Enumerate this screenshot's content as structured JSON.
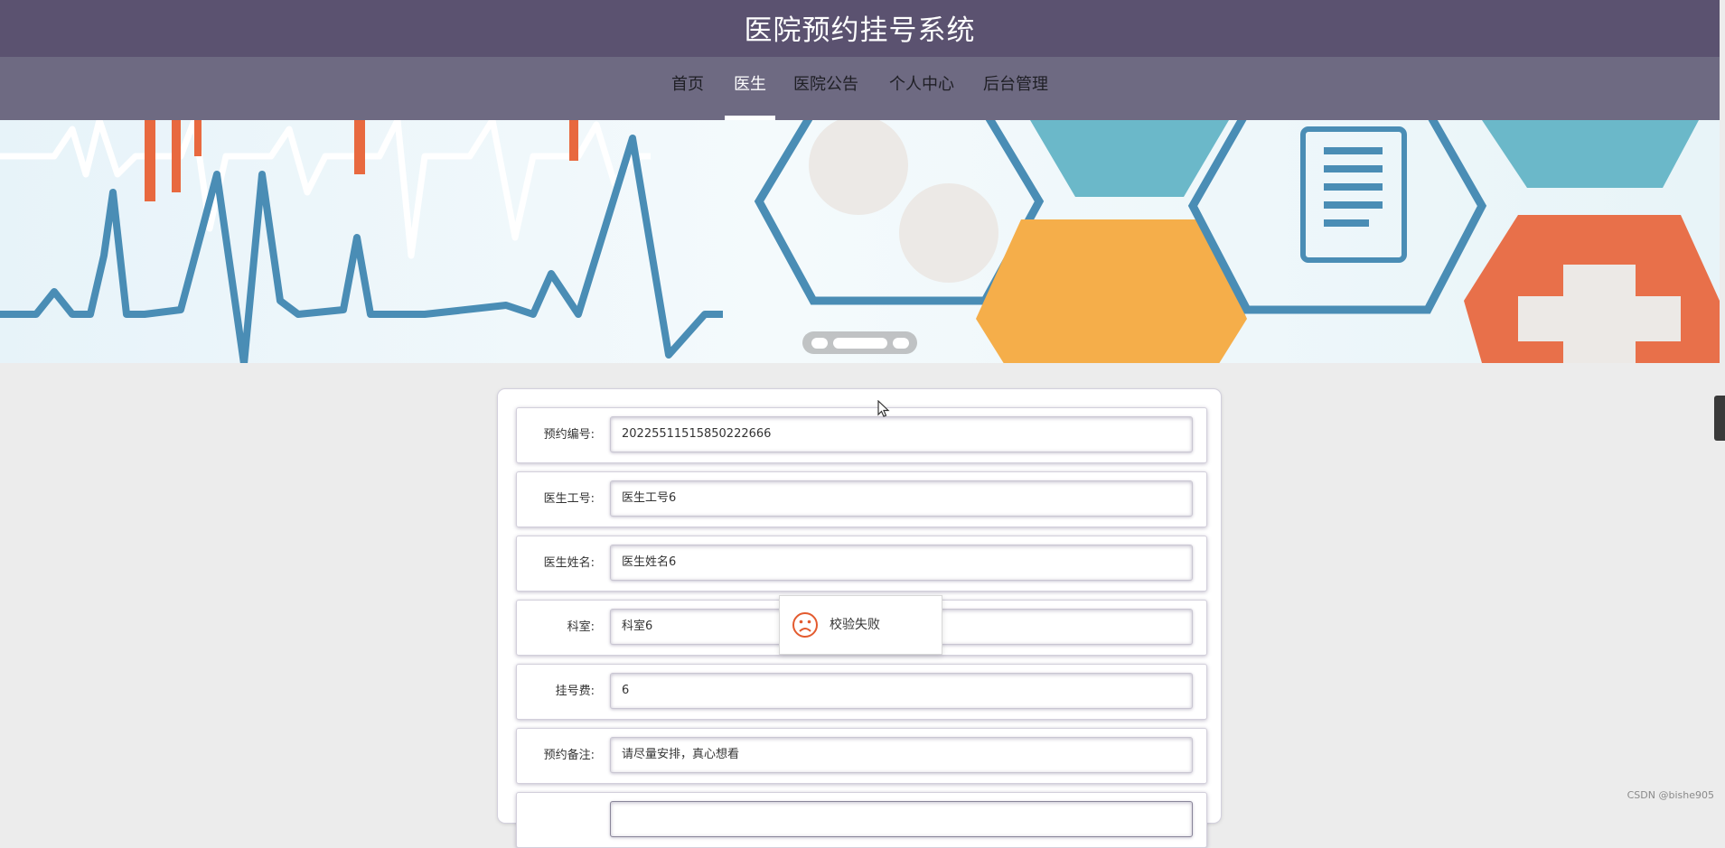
{
  "header": {
    "title": "医院预约挂号系统"
  },
  "nav": {
    "items": [
      {
        "label": "首页",
        "active": false
      },
      {
        "label": "医生",
        "active": true
      },
      {
        "label": "医院公告",
        "active": false
      },
      {
        "label": "个人中心",
        "active": false
      },
      {
        "label": "后台管理",
        "active": false
      }
    ]
  },
  "form": {
    "fields": [
      {
        "label": "预约编号:",
        "value": "20225511515850222666"
      },
      {
        "label": "医生工号:",
        "value": "医生工号6"
      },
      {
        "label": "医生姓名:",
        "value": "医生姓名6"
      },
      {
        "label": "科室:",
        "value": "科室6"
      },
      {
        "label": "挂号费:",
        "value": "6"
      },
      {
        "label": "预约备注:",
        "value": "请尽量安排，真心想看"
      }
    ]
  },
  "toast": {
    "message": "校验失败",
    "icon": "sad-face-icon"
  },
  "watermark": "CSDN @bishe905",
  "colors": {
    "header_bg": "#5b5270",
    "nav_bg": "#6e6a82",
    "page_bg": "#ececec",
    "toast_icon": "#e35b2f"
  }
}
